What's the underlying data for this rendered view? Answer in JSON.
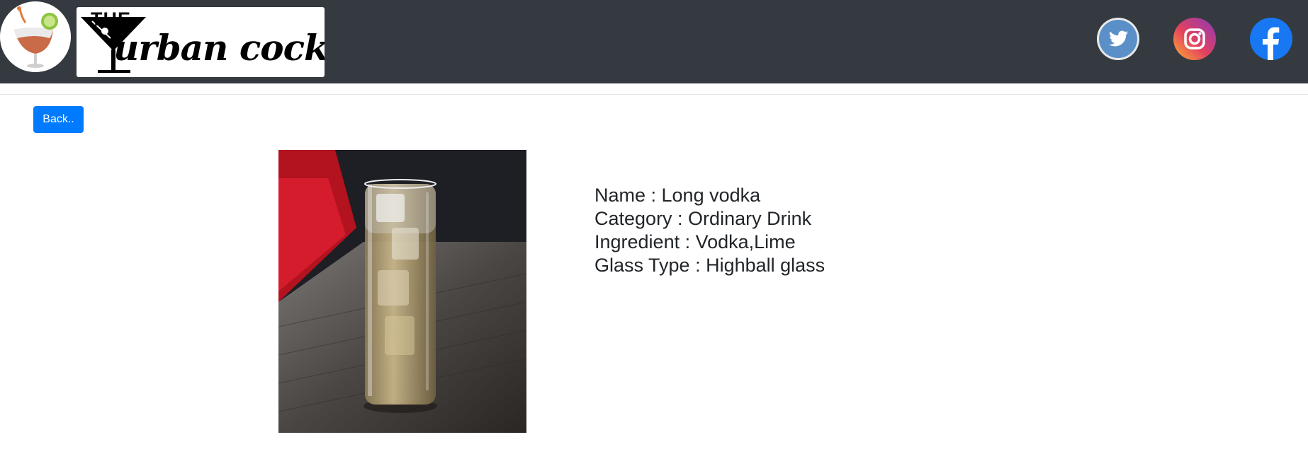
{
  "header": {
    "brand_top": "THE",
    "brand_script": "urban cocktail",
    "social": [
      {
        "name": "twitter-icon",
        "color": "#5b8fc8"
      },
      {
        "name": "instagram-icon",
        "color": "#d6336c"
      },
      {
        "name": "facebook-icon",
        "color": "#1877f2"
      }
    ]
  },
  "back_button": {
    "label": "Back.."
  },
  "drink": {
    "image_alt": "",
    "name_line": "Name : Long vodka",
    "category_line": "Category : Ordinary Drink",
    "ingredient_line": "Ingredient : Vodka,Lime",
    "glass_line": "Glass Type : Highball glass"
  },
  "colors": {
    "navbar": "#343a40",
    "button": "#007bff"
  }
}
